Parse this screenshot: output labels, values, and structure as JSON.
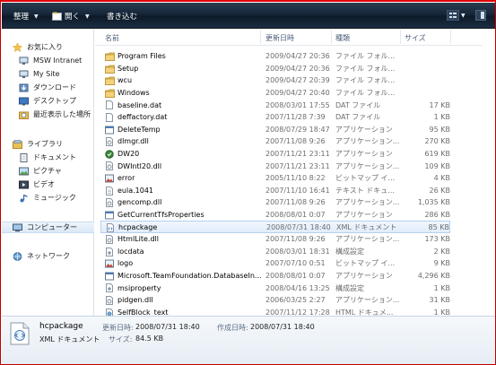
{
  "toolbar": {
    "organize_label": "整理",
    "open_label": "開く",
    "burn_label": "書き込む"
  },
  "nav": {
    "favorites_label": "お気に入り",
    "favorites": [
      "MSW Intranet",
      "My Site",
      "ダウンロード",
      "デスクトップ",
      "最近表示した場所"
    ],
    "libraries_label": "ライブラリ",
    "libraries": [
      "ドキュメント",
      "ピクチャ",
      "ビデオ",
      "ミュージック"
    ],
    "computer_label": "コンピューター",
    "network_label": "ネットワーク"
  },
  "columns": {
    "name": "名前",
    "date": "更新日時",
    "type": "種類",
    "size": "サイズ"
  },
  "files": [
    {
      "name": "Program Files",
      "date": "2009/04/27 20:36",
      "type": "ファイル フォル...",
      "size": "",
      "icon": "folder-icon"
    },
    {
      "name": "Setup",
      "date": "2009/04/27 20:36",
      "type": "ファイル フォル...",
      "size": "",
      "icon": "folder-icon"
    },
    {
      "name": "wcu",
      "date": "2009/04/27 20:39",
      "type": "ファイル フォル...",
      "size": "",
      "icon": "folder-icon"
    },
    {
      "name": "Windows",
      "date": "2009/04/27 20:40",
      "type": "ファイル フォル...",
      "size": "",
      "icon": "folder-icon"
    },
    {
      "name": "baseline.dat",
      "date": "2008/03/01 17:55",
      "type": "DAT ファイル",
      "size": "17 KB",
      "icon": "file-icon"
    },
    {
      "name": "deffactory.dat",
      "date": "2007/11/28 7:39",
      "type": "DAT ファイル",
      "size": "1 KB",
      "icon": "file-icon"
    },
    {
      "name": "DeleteTemp",
      "date": "2008/07/29 18:47",
      "type": "アプリケーション",
      "size": "95 KB",
      "icon": "app-icon"
    },
    {
      "name": "dlmgr.dll",
      "date": "2007/11/08 9:26",
      "type": "アプリケーション...",
      "size": "270 KB",
      "icon": "dll-icon"
    },
    {
      "name": "DW20",
      "date": "2007/11/21 23:11",
      "type": "アプリケーション",
      "size": "619 KB",
      "icon": "dw-icon"
    },
    {
      "name": "DWIntl20.dll",
      "date": "2007/11/21 23:11",
      "type": "アプリケーション...",
      "size": "109 KB",
      "icon": "dll-icon"
    },
    {
      "name": "error",
      "date": "2005/11/10 8:22",
      "type": "ビットマップ イ...",
      "size": "4 KB",
      "icon": "image-icon"
    },
    {
      "name": "eula.1041",
      "date": "2007/11/10 16:41",
      "type": "テキスト ドキュ...",
      "size": "26 KB",
      "icon": "text-icon"
    },
    {
      "name": "gencomp.dll",
      "date": "2007/11/08 9:26",
      "type": "アプリケーション...",
      "size": "1,035 KB",
      "icon": "dll-icon"
    },
    {
      "name": "GetCurrentTfsProperties",
      "date": "2008/08/01 0:07",
      "type": "アプリケーション",
      "size": "286 KB",
      "icon": "app-icon"
    },
    {
      "name": "hcpackage",
      "date": "2008/07/31 18:40",
      "type": "XML ドキュメント",
      "size": "85 KB",
      "icon": "xml-icon"
    },
    {
      "name": "HtmlLite.dll",
      "date": "2007/11/08 9:26",
      "type": "アプリケーション...",
      "size": "173 KB",
      "icon": "dll-icon"
    },
    {
      "name": "locdata",
      "date": "2008/03/01 18:31",
      "type": "構成設定",
      "size": "2 KB",
      "icon": "config-icon"
    },
    {
      "name": "logo",
      "date": "2007/07/10 0:51",
      "type": "ビットマップ イ...",
      "size": "9 KB",
      "icon": "image-icon"
    },
    {
      "name": "Microsoft.TeamFoundation.DatabaseIn...",
      "date": "2008/08/01 0:07",
      "type": "アプリケーション",
      "size": "4,296 KB",
      "icon": "app-icon"
    },
    {
      "name": "msiproperty",
      "date": "2008/04/16 13:25",
      "type": "構成設定",
      "size": "1 KB",
      "icon": "config-icon"
    },
    {
      "name": "pidgen.dll",
      "date": "2006/03/25 2:27",
      "type": "アプリケーション...",
      "size": "31 KB",
      "icon": "dll-icon"
    },
    {
      "name": "SelfBlock_text",
      "date": "2007/11/12 17:28",
      "type": "HTML ドキュメ...",
      "size": "1 KB",
      "icon": "html-icon"
    }
  ],
  "selected_index": 14,
  "details": {
    "name": "hcpackage",
    "type": "XML ドキュメント",
    "modified_label": "更新日時:",
    "modified": "2008/07/31 18:40",
    "created_label": "作成日時:",
    "created": "2008/07/31 18:40",
    "size_label": "サイズ:",
    "size": "84.5 KB"
  },
  "colors": {
    "toolbar": "#16273a",
    "selection": "#e0ecfb",
    "folder": "#e8c15a",
    "frame_red": "#d00000"
  }
}
